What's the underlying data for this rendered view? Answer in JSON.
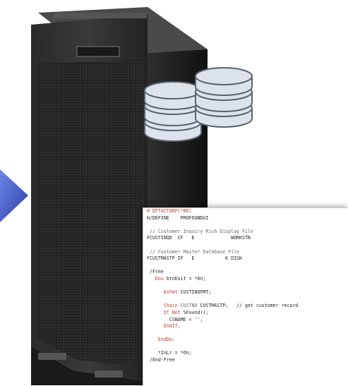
{
  "colors": {
    "server_dark": "#1e1e1e",
    "server_mid": "#3a3a3a",
    "arrow_blue": "#3f56c8",
    "db_fill": "#dde3ea",
    "db_stroke": "#5a6470",
    "code_red": "#c0392b",
    "code_text": "#222222"
  },
  "icons": {
    "arrow": "arrow-right-icon",
    "database": "database-icon",
    "server": "server-tower-icon"
  },
  "code": {
    "lines": [
      {
        "indent": 0,
        "parts": [
          {
            "t": "H DFTACTGRP(*NO)",
            "c": "red"
          }
        ]
      },
      {
        "indent": 0,
        "parts": [
          {
            "t": "H/DEFINE    PROFOUNDUI",
            "c": "text"
          }
        ]
      },
      {
        "indent": 0,
        "parts": [
          {
            "t": "",
            "c": "text"
          }
        ]
      },
      {
        "indent": 1,
        "parts": [
          {
            "t": "// Customer Inquiry Rich Display File",
            "c": "grey"
          }
        ]
      },
      {
        "indent": 0,
        "parts": [
          {
            "t": "FCUSTINQD  CF   E             WORKSTN",
            "c": "text"
          }
        ]
      },
      {
        "indent": 0,
        "parts": [
          {
            "t": "",
            "c": "text"
          }
        ]
      },
      {
        "indent": 1,
        "parts": [
          {
            "t": "// Customer Master Database File",
            "c": "grey"
          }
        ]
      },
      {
        "indent": 0,
        "parts": [
          {
            "t": "FCUSTMASTP IF   E           K DISK",
            "c": "text"
          }
        ]
      },
      {
        "indent": 0,
        "parts": [
          {
            "t": "",
            "c": "text"
          }
        ]
      },
      {
        "indent": 1,
        "parts": [
          {
            "t": "/Free",
            "c": "text"
          }
        ]
      },
      {
        "indent": 3,
        "parts": [
          {
            "t": "Dou ",
            "c": "red"
          },
          {
            "t": "btnExit = *On;",
            "c": "text"
          }
        ]
      },
      {
        "indent": 0,
        "parts": [
          {
            "t": "",
            "c": "text"
          }
        ]
      },
      {
        "indent": 6,
        "parts": [
          {
            "t": "ExFmt ",
            "c": "red"
          },
          {
            "t": "CUSTINQFMT;",
            "c": "text"
          }
        ]
      },
      {
        "indent": 0,
        "parts": [
          {
            "t": "",
            "c": "text"
          }
        ]
      },
      {
        "indent": 6,
        "parts": [
          {
            "t": "Chain ",
            "c": "red"
          },
          {
            "t": "CUSTNO ",
            "c": "grey"
          },
          {
            "t": "CUSTMASTP;   // get customer record",
            "c": "text"
          }
        ]
      },
      {
        "indent": 6,
        "parts": [
          {
            "t": "If Not ",
            "c": "red"
          },
          {
            "t": "%Found();",
            "c": "text"
          }
        ]
      },
      {
        "indent": 8,
        "parts": [
          {
            "t": "CSNAME = '';",
            "c": "text"
          }
        ]
      },
      {
        "indent": 6,
        "parts": [
          {
            "t": "EndIf;",
            "c": "red"
          }
        ]
      },
      {
        "indent": 0,
        "parts": [
          {
            "t": "",
            "c": "text"
          }
        ]
      },
      {
        "indent": 4,
        "parts": [
          {
            "t": "EndDo;",
            "c": "red"
          }
        ]
      },
      {
        "indent": 0,
        "parts": [
          {
            "t": "",
            "c": "text"
          }
        ]
      },
      {
        "indent": 4,
        "parts": [
          {
            "t": "*InLr = *On;",
            "c": "text"
          }
        ]
      },
      {
        "indent": 1,
        "parts": [
          {
            "t": "/End-Free",
            "c": "text"
          }
        ]
      }
    ]
  }
}
